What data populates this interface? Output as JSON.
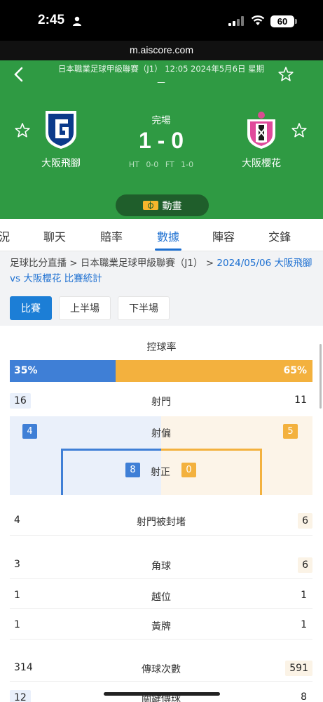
{
  "status_bar": {
    "time": "2:45",
    "battery": "60"
  },
  "url": "m.aiscore.com",
  "match": {
    "league_info": "日本職業足球甲級聯賽（J1）  12:05 2024年5月6日 星期一",
    "status": "完場",
    "score": "1 - 0",
    "half_time": "HT 0-0",
    "full_time": "FT 1-0",
    "home_team": "大阪飛腳",
    "away_team": "大阪櫻花",
    "animation_label": "動畫"
  },
  "tabs": [
    "況",
    "聊天",
    "賠率",
    "數據",
    "陣容",
    "交鋒"
  ],
  "breadcrumb": {
    "part1": "足球比分直播",
    "part2": "日本職業足球甲級聯賽（J1）",
    "current": "2024/05/06 大阪飛腳 vs 大阪櫻花 比賽統計"
  },
  "period_tabs": [
    "比賽",
    "上半場",
    "下半場"
  ],
  "stats": {
    "possession": {
      "label": "控球率",
      "home": "35%",
      "away": "65%",
      "home_value": 35,
      "away_value": 65
    },
    "shots": {
      "label": "射門",
      "home": "16",
      "away": "11"
    },
    "shots_off_target": {
      "label": "射偏",
      "home": "4",
      "away": "5"
    },
    "shots_on_target": {
      "label": "射正",
      "home": "8",
      "away": "0"
    },
    "blocked_shots": {
      "label": "射門被封堵",
      "home": "4",
      "away": "6"
    },
    "corners": {
      "label": "角球",
      "home": "3",
      "away": "6"
    },
    "offsides": {
      "label": "越位",
      "home": "1",
      "away": "1"
    },
    "yellow_cards": {
      "label": "黃牌",
      "home": "1",
      "away": "1"
    },
    "passes": {
      "label": "傳球次數",
      "home": "314",
      "away": "591"
    },
    "key_passes": {
      "label": "關鍵傳球",
      "home": "12",
      "away": "8"
    }
  },
  "colors": {
    "header_green": "#2f9a43",
    "home_blue": "#3f7fd6",
    "away_orange": "#f3b13e",
    "link_blue": "#1c6fd1"
  }
}
